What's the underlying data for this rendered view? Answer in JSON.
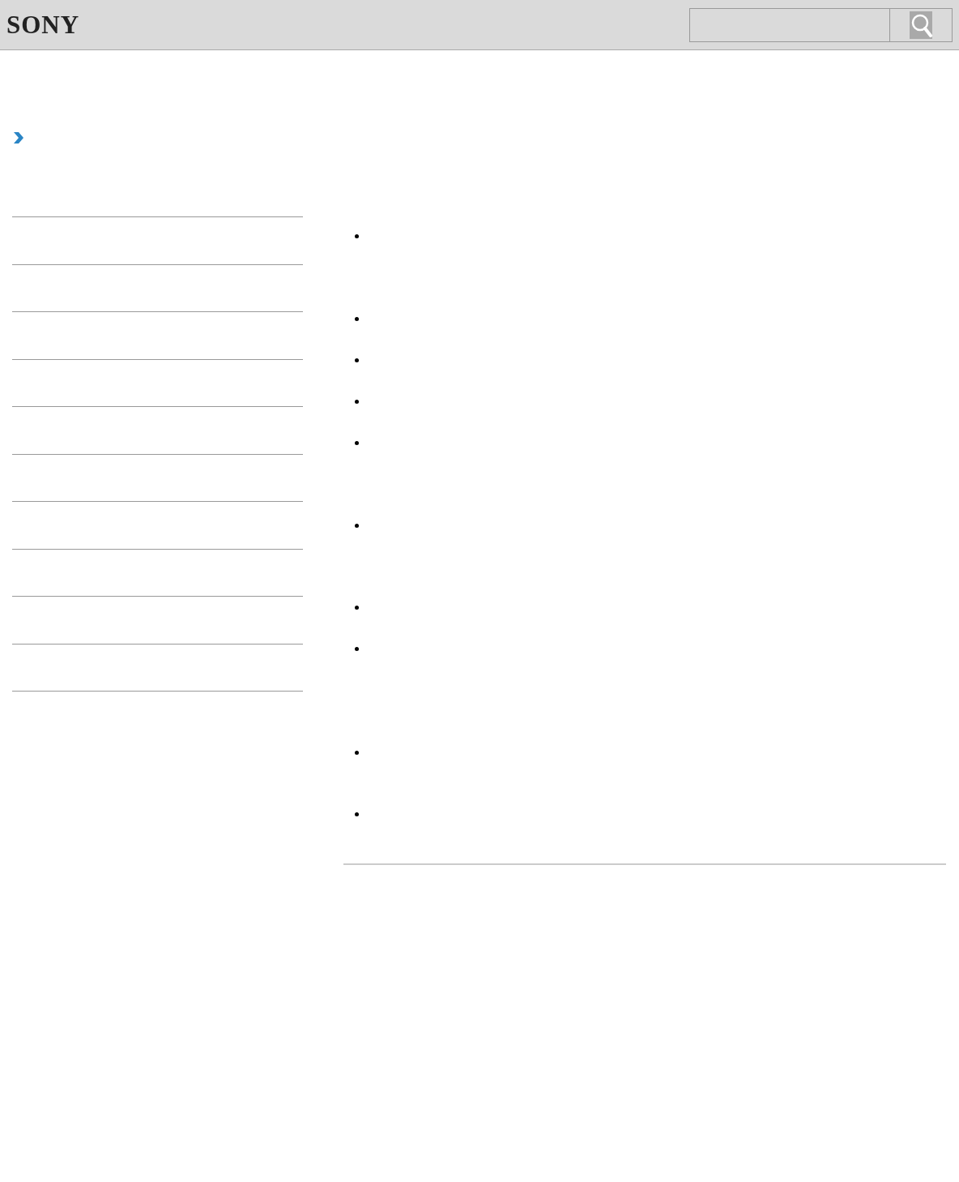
{
  "header": {
    "logo": "SONY",
    "search": {
      "kind": "search"
    }
  }
}
